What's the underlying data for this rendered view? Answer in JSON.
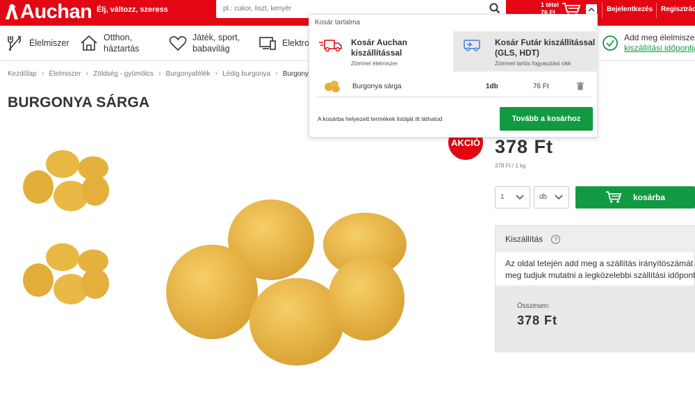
{
  "header": {
    "logo_text": "Auchan",
    "tagline": "Élj, változz, szeress",
    "search_placeholder": "pl.: cukor, liszt, kenyér",
    "cart_items": "1  tétel",
    "cart_sum": "76  Ft",
    "login": "Bejelentkezés",
    "register": "Regisztráció"
  },
  "nav": {
    "food": "Élelmiszer",
    "home_line1": "Otthon,",
    "home_line2": "háztartás",
    "toys_line1": "Játék, sport,",
    "toys_line2": "babavilág",
    "electronics": "Elektronika",
    "delivery_line1": "Add meg élelmiszer",
    "delivery_line2": "kiszállítási időpontja"
  },
  "breadcrumb": [
    "Kezdőlap",
    "Élelmiszer",
    "Zöldség - gyümölcs",
    "Burgonyafélék",
    "Lédig burgonya",
    "Burgonya sárga"
  ],
  "product": {
    "title": "BURGONYA SÁRGA",
    "badge": "AKCIÓ",
    "price": "378  Ft",
    "unit_price": "378 Ft / 1 kg",
    "qty_value": "1",
    "qty_unit": "db",
    "add_to_cart": "kosárba"
  },
  "shipping": {
    "header": "Kiszállítás",
    "help": "?",
    "text_line1": "Az oldal tetején add meg a szállítás irányítószámát és",
    "text_line2": "meg tudjuk mutatni a legközelebbi szállítási időpontot",
    "total_label": "Összesen:",
    "total_value": "378  Ft"
  },
  "cart_popup": {
    "header": "Kosár tartalma",
    "col1_title_1": "Kosár Auchan",
    "col1_title_2": "kiszállítással",
    "col1_sub": "Zömmel élelmiszer",
    "col2_title_1": "Kosár Futár kiszállítással",
    "col2_title_2": "(GLS, HDT)",
    "col2_sub": "Zömmel tartós fogyasztási cikk",
    "item_name": "Burgonya sárga",
    "item_qty": "1db",
    "item_price": "76 Ft",
    "footer_text": "A kosárba helyezett termékek listáját itt láthatod",
    "checkout": "Tovább a kosárhoz"
  },
  "colors": {
    "brand_red": "#e30613",
    "green": "#129a42"
  }
}
